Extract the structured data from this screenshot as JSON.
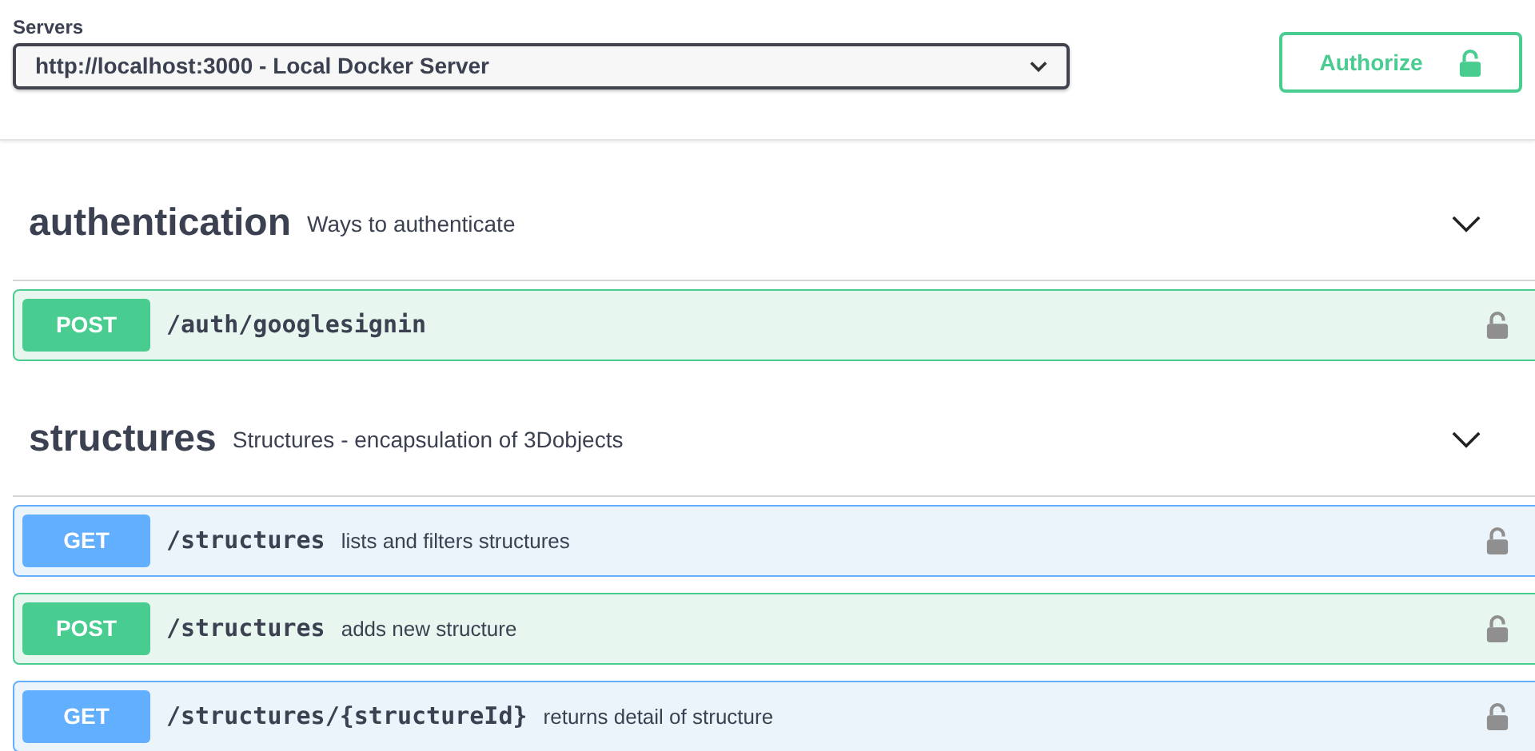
{
  "servers": {
    "label": "Servers",
    "value": "http://localhost:3000 - Local Docker Server"
  },
  "authorize": {
    "label": "Authorize",
    "locked": false
  },
  "sections": [
    {
      "name": "authentication",
      "description": "Ways to authenticate",
      "expanded": true,
      "operations": [
        {
          "method": "POST",
          "path": "/auth/googlesignin",
          "locked": false
        }
      ]
    },
    {
      "name": "structures",
      "description": "Structures - encapsulation of 3Dobjects",
      "expanded": true,
      "operations": [
        {
          "method": "GET",
          "path": "/structures",
          "summary": "lists and filters structures",
          "locked": false
        },
        {
          "method": "POST",
          "path": "/structures",
          "summary": "adds new structure",
          "locked": false
        },
        {
          "method": "GET",
          "path": "/structures/{structureId}",
          "summary": "returns detail of structure",
          "locked": false
        }
      ]
    }
  ]
}
